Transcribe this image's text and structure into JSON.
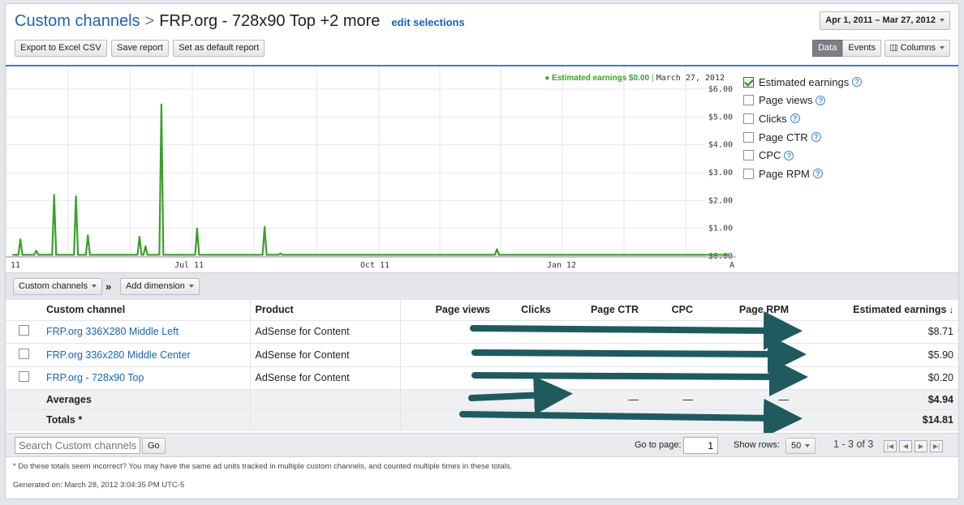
{
  "breadcrumb": {
    "parent": "Custom channels",
    "separator": ">",
    "current": "FRP.org - 728x90 Top +2 more",
    "edit_label": "edit selections"
  },
  "toolbar": {
    "export_label": "Export to Excel CSV",
    "save_label": "Save report",
    "default_label": "Set as default report",
    "date_range": "Apr 1, 2011 – Mar 27, 2012",
    "data_label": "Data",
    "events_label": "Events",
    "columns_label": "Columns"
  },
  "chart_data": {
    "type": "line",
    "header_metric": "Estimated earnings $0.00",
    "header_date": "March 27, 2012",
    "x_tick_labels": [
      "11",
      "Jul 11",
      "Oct 11",
      "Jan 12",
      "A"
    ],
    "y_tick_labels": [
      "$6.00",
      "$5.00",
      "$4.00",
      "$3.00",
      "$2.00",
      "$1.00",
      "$0.00"
    ],
    "ylim": [
      0,
      6
    ],
    "grid": true,
    "color": "#3aa02a",
    "series": [
      {
        "x": [
          "2011-04-01",
          "2011-04-04",
          "2011-04-05",
          "2011-04-06",
          "2011-04-12",
          "2011-04-13",
          "2011-04-14",
          "2011-04-21",
          "2011-04-22",
          "2011-04-23",
          "2011-05-02",
          "2011-05-03",
          "2011-05-04",
          "2011-05-08",
          "2011-05-09",
          "2011-05-10",
          "2011-06-03",
          "2011-06-04",
          "2011-06-05",
          "2011-06-06",
          "2011-06-07",
          "2011-06-08",
          "2011-06-14",
          "2011-06-15",
          "2011-06-16",
          "2011-06-17",
          "2011-06-18",
          "2011-07-02",
          "2011-07-03",
          "2011-07-04",
          "2011-07-05",
          "2011-07-06",
          "2011-08-05",
          "2011-08-06",
          "2011-08-07",
          "2011-08-13",
          "2011-08-14",
          "2011-08-15",
          "2011-08-21",
          "2011-08-22",
          "2011-08-23",
          "2011-11-30",
          "2011-12-01",
          "2011-12-02",
          "2012-03-27"
        ],
        "values": [
          0.05,
          0.05,
          0.6,
          0.05,
          0.05,
          0.2,
          0.05,
          0.05,
          2.2,
          0.05,
          0.05,
          2.15,
          0.05,
          0.05,
          0.75,
          0.05,
          0.05,
          0.7,
          0.05,
          0.05,
          0.35,
          0.05,
          0.05,
          5.45,
          0.05,
          0.05,
          0.05,
          0.05,
          1.0,
          0.05,
          0.05,
          0.05,
          0.05,
          1.05,
          0.05,
          0.05,
          0.1,
          0.05,
          0.05,
          0.05,
          0.05,
          0.05,
          0.25,
          0.05,
          0.05
        ]
      }
    ]
  },
  "metrics": [
    {
      "label": "Estimated earnings",
      "checked": true
    },
    {
      "label": "Page views",
      "checked": false
    },
    {
      "label": "Clicks",
      "checked": false
    },
    {
      "label": "Page CTR",
      "checked": false
    },
    {
      "label": "CPC",
      "checked": false
    },
    {
      "label": "Page RPM",
      "checked": false
    }
  ],
  "dimension_bar": {
    "channels_label": "Custom channels",
    "raquo": "»",
    "add_label": "Add dimension"
  },
  "table": {
    "headers": {
      "channel": "Custom channel",
      "product": "Product",
      "page_views": "Page views",
      "clicks": "Clicks",
      "page_ctr": "Page CTR",
      "cpc": "CPC",
      "page_rpm": "Page RPM",
      "earnings": "Estimated earnings"
    },
    "rows": [
      {
        "channel": "FRP.org 336X280 Middle Left",
        "product": "AdSense for Content",
        "earnings": "$8.71"
      },
      {
        "channel": "FRP.org 336x280 Middle Center",
        "product": "AdSense for Content",
        "earnings": "$5.90"
      },
      {
        "channel": "FRP.org - 728x90 Top",
        "product": "AdSense for Content",
        "earnings": "$0.20"
      }
    ],
    "averages": {
      "label": "Averages",
      "page_ctr": "—",
      "cpc": "—",
      "page_rpm": "—",
      "earnings": "$4.94"
    },
    "totals": {
      "label": "Totals *",
      "earnings": "$14.81"
    }
  },
  "footer": {
    "search_placeholder": "Search Custom channels",
    "go_label": "Go",
    "goto_label": "Go to page:",
    "goto_value": "1",
    "rows_label": "Show rows:",
    "rows_value": "50",
    "range_text": "1 - 3 of 3",
    "note": "* Do these totals seem incorrect? You may have the same ad units tracked in multiple custom channels, and counted multiple times in these totals.",
    "generated": "Generated on: March 28, 2012 3:04:35 PM UTC-5"
  }
}
